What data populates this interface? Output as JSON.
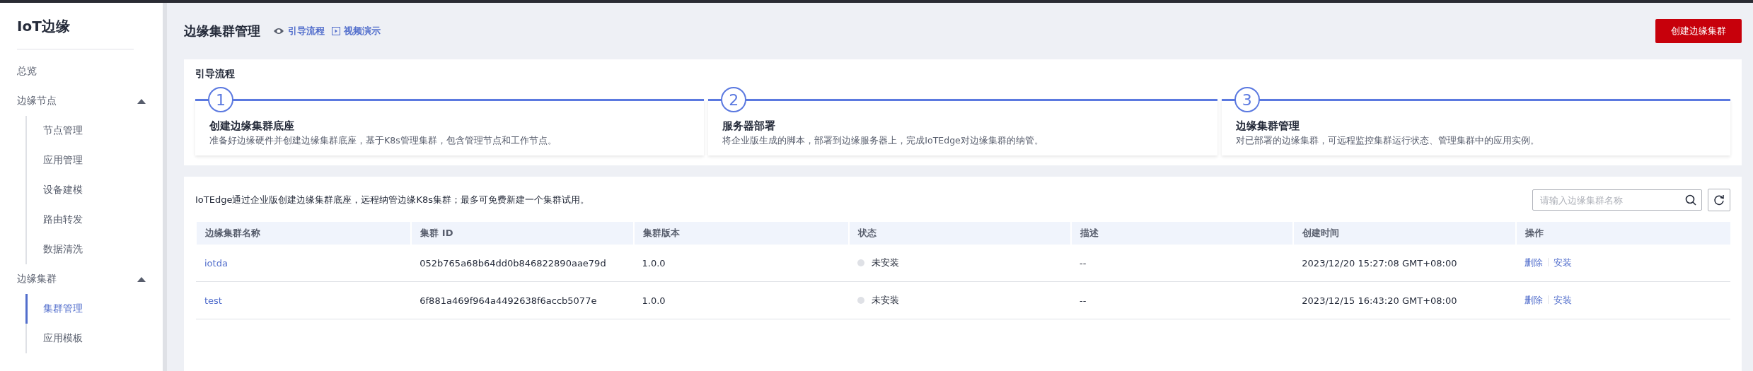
{
  "sidebar": {
    "title": "IoT边缘",
    "items": [
      {
        "label": "总览",
        "selected": false
      },
      {
        "label": "边缘节点",
        "expanded": true,
        "children": [
          {
            "label": "节点管理",
            "selected": false
          },
          {
            "label": "应用管理",
            "selected": false
          },
          {
            "label": "设备建模",
            "selected": false
          },
          {
            "label": "路由转发",
            "selected": false
          },
          {
            "label": "数据清洗",
            "selected": false
          }
        ]
      },
      {
        "label": "边缘集群",
        "expanded": true,
        "children": [
          {
            "label": "集群管理",
            "selected": true
          },
          {
            "label": "应用模板",
            "selected": false
          }
        ]
      }
    ]
  },
  "header": {
    "title": "边缘集群管理",
    "links": [
      {
        "kind": "eye",
        "label": "引导流程"
      },
      {
        "kind": "video",
        "label": "视频演示"
      }
    ],
    "primary_button": "创建边缘集群"
  },
  "guide": {
    "title": "引导流程",
    "steps": [
      {
        "number": "1",
        "title": "创建边缘集群底座",
        "description": "准备好边缘硬件并创建边缘集群底座，基于K8s管理集群，包含管理节点和工作节点。"
      },
      {
        "number": "2",
        "title": "服务器部署",
        "description": "将企业版生成的脚本，部署到边缘服务器上，完成IoTEdge对边缘集群的纳管。"
      },
      {
        "number": "3",
        "title": "边缘集群管理",
        "description": "对已部署的边缘集群，可远程监控集群运行状态、管理集群中的应用实例。"
      }
    ]
  },
  "clusters": {
    "notice": "IoTEdge通过企业版创建边缘集群底座，远程纳管边缘K8s集群；最多可免费新建一个集群试用。",
    "search": {
      "placeholder": "请输入边缘集群名称"
    },
    "columns": [
      "边缘集群名称",
      "集群 ID",
      "集群版本",
      "状态",
      "描述",
      "创建时间",
      "操作"
    ],
    "rows": [
      {
        "name": "iotda",
        "id": "052b765a68b64dd0b846822890aae79d",
        "version": "1.0.0",
        "status": "未安装",
        "description": "--",
        "created": "2023/12/20 15:27:08 GMT+08:00",
        "actions": [
          "删除",
          "安装"
        ]
      },
      {
        "name": "test",
        "id": "6f881a469f964a4492638f6accb5077e",
        "version": "1.0.0",
        "status": "未安装",
        "description": "--",
        "created": "2023/12/15 16:43:20 GMT+08:00",
        "actions": [
          "删除",
          "安装"
        ]
      }
    ]
  }
}
